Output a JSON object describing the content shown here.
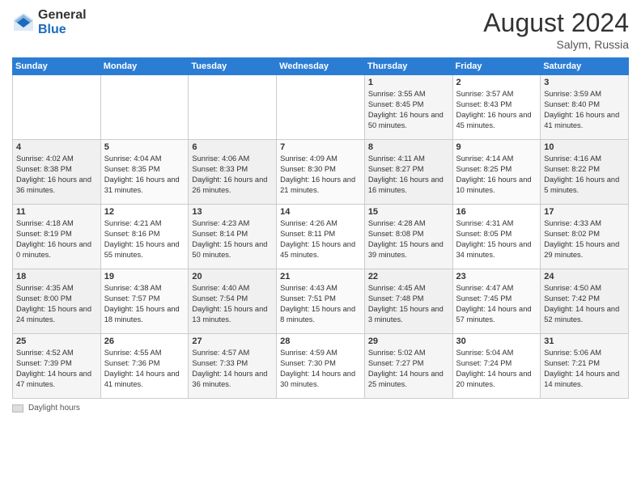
{
  "header": {
    "logo_general": "General",
    "logo_blue": "Blue",
    "title": "August 2024",
    "location": "Salym, Russia"
  },
  "calendar": {
    "days": [
      "Sunday",
      "Monday",
      "Tuesday",
      "Wednesday",
      "Thursday",
      "Friday",
      "Saturday"
    ]
  },
  "legend": {
    "label": "Daylight hours"
  },
  "weeks": [
    [
      {
        "num": "",
        "info": ""
      },
      {
        "num": "",
        "info": ""
      },
      {
        "num": "",
        "info": ""
      },
      {
        "num": "",
        "info": ""
      },
      {
        "num": "1",
        "info": "Sunrise: 3:55 AM\nSunset: 8:45 PM\nDaylight: 16 hours and 50 minutes."
      },
      {
        "num": "2",
        "info": "Sunrise: 3:57 AM\nSunset: 8:43 PM\nDaylight: 16 hours and 45 minutes."
      },
      {
        "num": "3",
        "info": "Sunrise: 3:59 AM\nSunset: 8:40 PM\nDaylight: 16 hours and 41 minutes."
      }
    ],
    [
      {
        "num": "4",
        "info": "Sunrise: 4:02 AM\nSunset: 8:38 PM\nDaylight: 16 hours and 36 minutes."
      },
      {
        "num": "5",
        "info": "Sunrise: 4:04 AM\nSunset: 8:35 PM\nDaylight: 16 hours and 31 minutes."
      },
      {
        "num": "6",
        "info": "Sunrise: 4:06 AM\nSunset: 8:33 PM\nDaylight: 16 hours and 26 minutes."
      },
      {
        "num": "7",
        "info": "Sunrise: 4:09 AM\nSunset: 8:30 PM\nDaylight: 16 hours and 21 minutes."
      },
      {
        "num": "8",
        "info": "Sunrise: 4:11 AM\nSunset: 8:27 PM\nDaylight: 16 hours and 16 minutes."
      },
      {
        "num": "9",
        "info": "Sunrise: 4:14 AM\nSunset: 8:25 PM\nDaylight: 16 hours and 10 minutes."
      },
      {
        "num": "10",
        "info": "Sunrise: 4:16 AM\nSunset: 8:22 PM\nDaylight: 16 hours and 5 minutes."
      }
    ],
    [
      {
        "num": "11",
        "info": "Sunrise: 4:18 AM\nSunset: 8:19 PM\nDaylight: 16 hours and 0 minutes."
      },
      {
        "num": "12",
        "info": "Sunrise: 4:21 AM\nSunset: 8:16 PM\nDaylight: 15 hours and 55 minutes."
      },
      {
        "num": "13",
        "info": "Sunrise: 4:23 AM\nSunset: 8:14 PM\nDaylight: 15 hours and 50 minutes."
      },
      {
        "num": "14",
        "info": "Sunrise: 4:26 AM\nSunset: 8:11 PM\nDaylight: 15 hours and 45 minutes."
      },
      {
        "num": "15",
        "info": "Sunrise: 4:28 AM\nSunset: 8:08 PM\nDaylight: 15 hours and 39 minutes."
      },
      {
        "num": "16",
        "info": "Sunrise: 4:31 AM\nSunset: 8:05 PM\nDaylight: 15 hours and 34 minutes."
      },
      {
        "num": "17",
        "info": "Sunrise: 4:33 AM\nSunset: 8:02 PM\nDaylight: 15 hours and 29 minutes."
      }
    ],
    [
      {
        "num": "18",
        "info": "Sunrise: 4:35 AM\nSunset: 8:00 PM\nDaylight: 15 hours and 24 minutes."
      },
      {
        "num": "19",
        "info": "Sunrise: 4:38 AM\nSunset: 7:57 PM\nDaylight: 15 hours and 18 minutes."
      },
      {
        "num": "20",
        "info": "Sunrise: 4:40 AM\nSunset: 7:54 PM\nDaylight: 15 hours and 13 minutes."
      },
      {
        "num": "21",
        "info": "Sunrise: 4:43 AM\nSunset: 7:51 PM\nDaylight: 15 hours and 8 minutes."
      },
      {
        "num": "22",
        "info": "Sunrise: 4:45 AM\nSunset: 7:48 PM\nDaylight: 15 hours and 3 minutes."
      },
      {
        "num": "23",
        "info": "Sunrise: 4:47 AM\nSunset: 7:45 PM\nDaylight: 14 hours and 57 minutes."
      },
      {
        "num": "24",
        "info": "Sunrise: 4:50 AM\nSunset: 7:42 PM\nDaylight: 14 hours and 52 minutes."
      }
    ],
    [
      {
        "num": "25",
        "info": "Sunrise: 4:52 AM\nSunset: 7:39 PM\nDaylight: 14 hours and 47 minutes."
      },
      {
        "num": "26",
        "info": "Sunrise: 4:55 AM\nSunset: 7:36 PM\nDaylight: 14 hours and 41 minutes."
      },
      {
        "num": "27",
        "info": "Sunrise: 4:57 AM\nSunset: 7:33 PM\nDaylight: 14 hours and 36 minutes."
      },
      {
        "num": "28",
        "info": "Sunrise: 4:59 AM\nSunset: 7:30 PM\nDaylight: 14 hours and 30 minutes."
      },
      {
        "num": "29",
        "info": "Sunrise: 5:02 AM\nSunset: 7:27 PM\nDaylight: 14 hours and 25 minutes."
      },
      {
        "num": "30",
        "info": "Sunrise: 5:04 AM\nSunset: 7:24 PM\nDaylight: 14 hours and 20 minutes."
      },
      {
        "num": "31",
        "info": "Sunrise: 5:06 AM\nSunset: 7:21 PM\nDaylight: 14 hours and 14 minutes."
      }
    ]
  ]
}
